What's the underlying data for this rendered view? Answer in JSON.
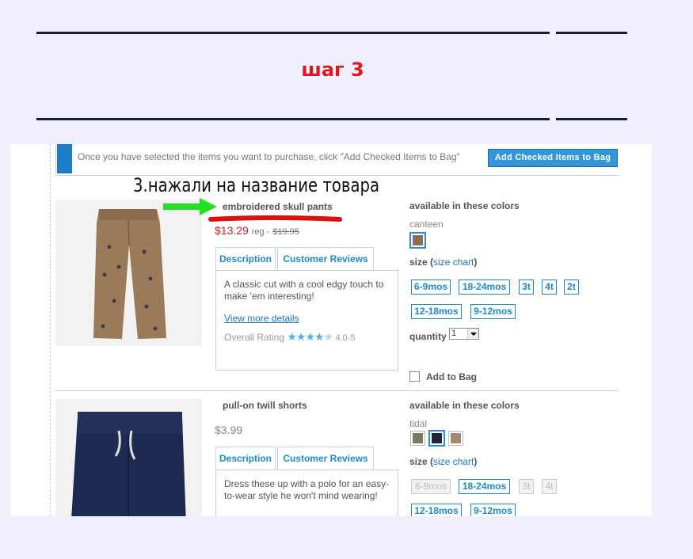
{
  "header": {
    "title": "шаг 3"
  },
  "annotation": {
    "text": "3.нажали на название товара"
  },
  "toolbar": {
    "instruction": "Once you have selected the items you want to purchase, click \"Add Checked Items to Bag\"",
    "add_checked_label": "Add Checked Items to Bag"
  },
  "products": [
    {
      "name": "embroidered skull pants",
      "sale_price": "$13.29",
      "reg_label": "reg -",
      "reg_price": "$19.95",
      "tabs": [
        "Description",
        "Customer Reviews"
      ],
      "description": "A classic cut with a cool edgy touch to make 'em interesting!",
      "view_more": "View more details",
      "rating_label": "Overall Rating",
      "rating_value": "4.0",
      "rating_scale": "5",
      "available_label": "available in these colors",
      "color_name": "canteen",
      "swatches": [
        "#8b6e55"
      ],
      "size_label": "size (",
      "size_chart": "size chart",
      "size_close": ")",
      "sizes": [
        "6-9mos",
        "18-24mos",
        "3t",
        "4t",
        "2t",
        "12-18mos",
        "9-12mos"
      ],
      "quantity_label": "quantity",
      "quantity_value": "1",
      "add_to_bag": "Add to Bag"
    },
    {
      "name": "pull-on twill shorts",
      "price": "$3.99",
      "tabs": [
        "Description",
        "Customer Reviews"
      ],
      "description": "Dress these up with a polo for an easy-to-wear style he won't mind wearing!",
      "available_label": "available in these colors",
      "color_name": "tidal",
      "swatches": [
        "#7a7a62",
        "#1e2540",
        "#a08a72"
      ],
      "size_label": "size (",
      "size_chart": "size chart",
      "size_close": ")",
      "sizes": [
        "6-9mos",
        "18-24mos",
        "3t",
        "4t",
        "12-18mos",
        "9-12mos"
      ],
      "unavailable_sizes": [
        "6-9mos",
        "3t",
        "4t"
      ]
    }
  ],
  "colors": {
    "accent": "#1c8ac8",
    "sale": "#e4141c",
    "title": "#e4141c"
  }
}
